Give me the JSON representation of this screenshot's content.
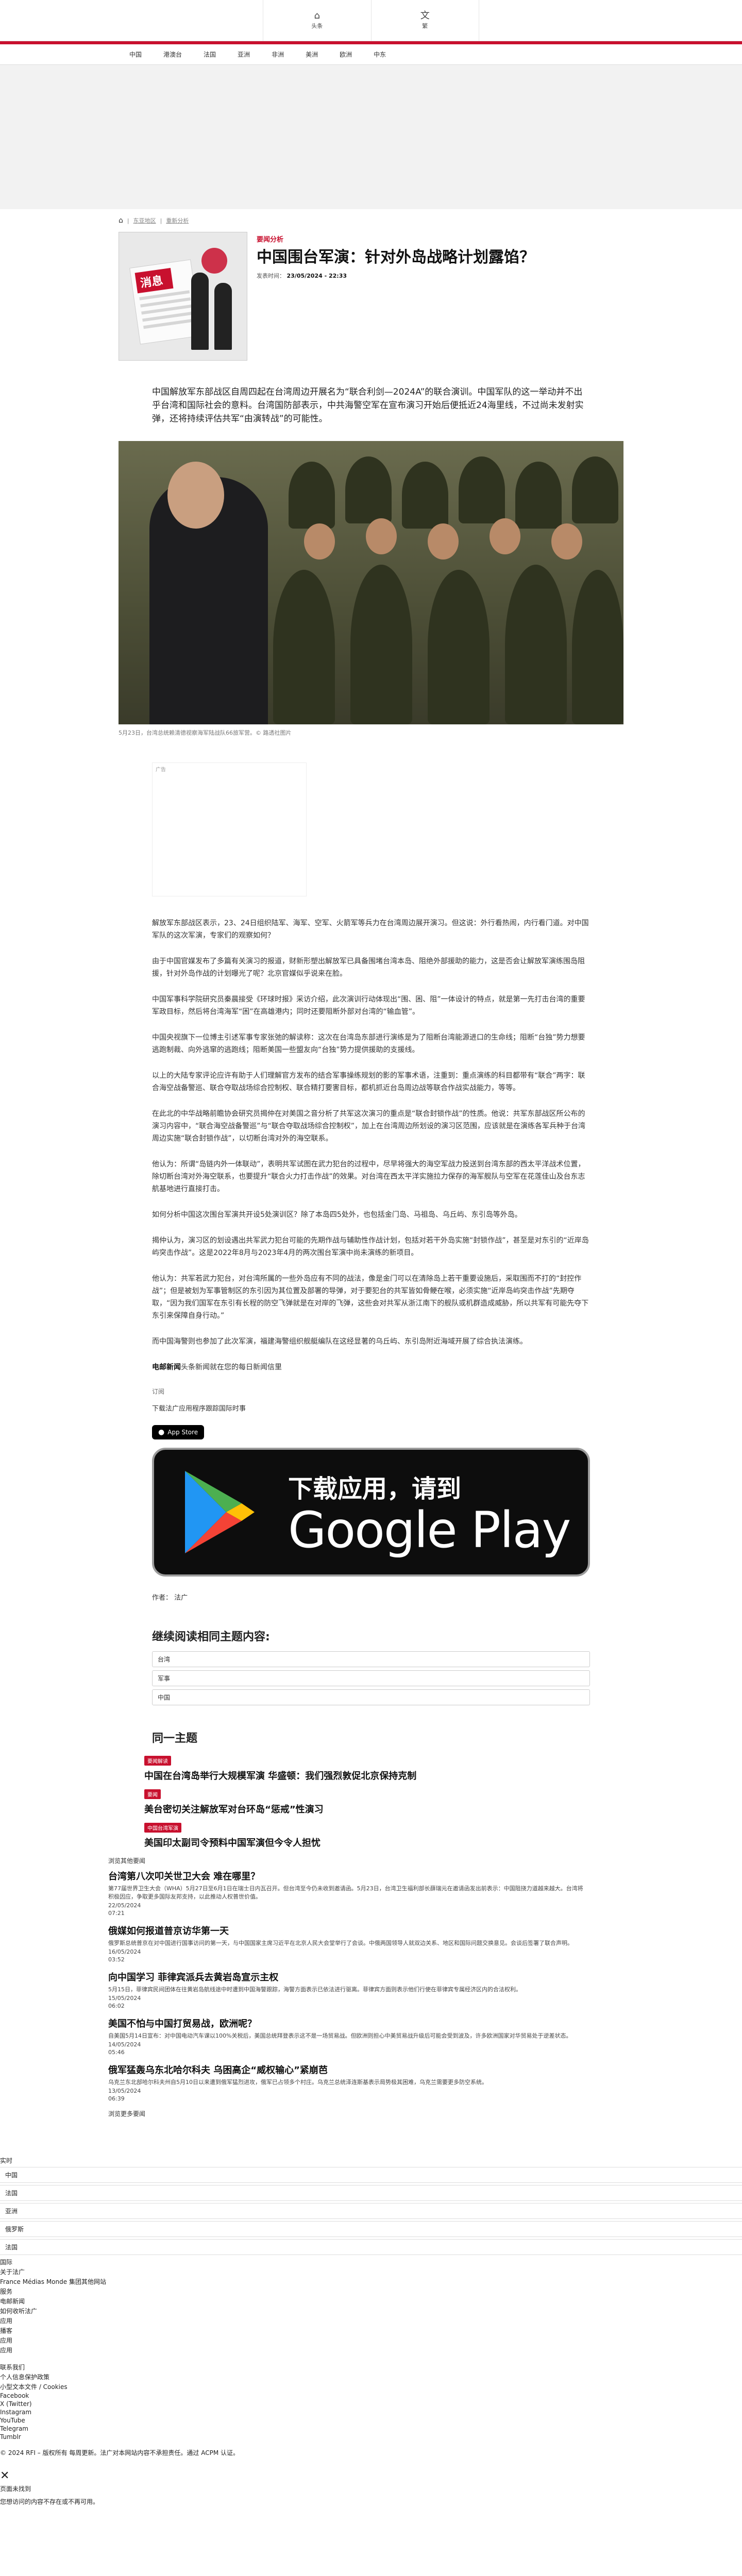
{
  "topbar": {
    "home_label": "头条",
    "lang_label": "繁"
  },
  "nav": [
    "中国",
    "港澳台",
    "法国",
    "亚洲",
    "非洲",
    "美洲",
    "欧洲",
    "中东"
  ],
  "breadcrumb": [
    "东亚地区",
    "重新分析"
  ],
  "article": {
    "kicker": "要闻分析",
    "title": "中国围台军演：针对外岛战略计划露馅？",
    "date_label": "发表时间：",
    "date": "23/05/2024 - 22:33",
    "lead": "中国解放军东部战区自周四起在台湾周边开展名为“联合利剑—2024A”的联合演训。中国军队的这一举动并不出乎台湾和国际社会的意料。台湾国防部表示，中共海警空军在宣布演习开始后便抵近24海里线，不过尚未发射实弹，还将持续评估共军“由演转战”的可能性。",
    "caption": "5月23日，台湾总统赖清德视察海军陆战队66旅军营。© 路透社图片",
    "ad_label": "广告",
    "paragraphs": [
      "解放军东部战区表示，23、24日组织陆军、海军、空军、火箭军等兵力在台湾周边展开演习。但这说：外行看热闹，内行看门道。对中国军队的这次军演，专家们的观察如何？",
      "由于中国官媒发布了多篇有关演习的报道，财新形塑出解放军已具备围堵台湾本岛、阻绝外部援助的能力，这是否会让解放军演练围岛阻援，针对外岛作战的计划曝光了呢？北京官媒似乎说来在脸。",
      "中国军事科学院研究员秦晨接受《环球时报》采访介绍，此次演训行动体现出“围、困、阻”一体设计的特点，就是第一先打击台湾的重要军政目标，然后将台湾海军“困”在高雄港内；同时还要阻断外部对台湾的“输血管”。",
      "中国央视旗下一位博主引述军事专家张弛的解读称：这次在台湾岛东部进行演练是为了阻断台湾能源进口的生命线；阻断“台独”势力想要逃跑制裁、向外逃窜的逃跑线；阻断美国一些盟友向“台独”势力提供援助的支援线。",
      "以上的大陆专家评论应许有助于人们理解官方发布的结合军事操练规划的影的军事术语，注重到：重点演练的科目都带有“联合”两字：联合海空战备警巡、联合夺取战场综合控制权、联合精打要害目标，都机抓近台岛周边战等联合作战实战能力，等等。",
      "在此北的中华战略前瞻协会研究员揭仲在对美国之音分析了共军这次演习的重点是“联合封锁作战”的性质。他说：共军东部战区所公布的演习内容中，“联合海空战备警巡”与“联合夺取战场综合控制权”，加上在台湾周边所划设的演习区范围，应该就是在演练各军兵种于台湾周边实施“联合封锁作战”，以切断台湾对外的海空联系。",
      "他认为：所谓“岛链内外一体联动”，表明共军试图在武力犯台的过程中，尽早将强大的海空军战力投送到台湾东部的西太平洋战术位置，除切断台湾对外海空联系，也要提升“联合火力打击作战”的效果。对台湾在西太平洋实施拉力保存的海军舰队与空军在花莲佳山及台东志航基地进行直接打击。",
      "如何分析中国这次围台军演共开设5处演训区？除了本岛四5处外，也包括金门岛、马祖岛、乌丘屿、东引岛等外岛。",
      "揭仲认为，演习区的划设遇出共军武力犯台可能的先期作战与辅助性作战计划，包括对若干外岛实施“封锁作战”，甚至是对东引的“近岸岛屿突击作战”。这是2022年8月与2023年4月的两次围台军演中尚未演练的新项目。",
      "他认为：共军若武力犯台，对台湾所属的一些外岛应有不同的战法，像是金门可以在清除岛上若干重要设施后，采取围而不打的“封控作战”；但是被划为军事管制区的东引因为其位置及部署的导弹，对于要犯台的共军皆如骨鲠在喉，必须实施“近岸岛屿突击作战”先期夺取，“因为我们国军在东引有长程的防空飞弹就是在对岸的飞弹，这些会对共军从浙江南下的舰队或机群造成威胁，所以共军有可能先夺下东引来保障自身行动。”",
      "而中国海警则也参加了此次军演，福建海警组织舰艇编队在这经显著的乌丘屿、东引岛附近海域开展了综合执法演练。"
    ],
    "promo_bold": "电邮新闻",
    "promo_rest": "头条新闻就在您的每日新闻信里",
    "subscribe_label": "订阅",
    "app_line": "下载法广应用程序跟踪国际时事",
    "appstore_label": "App Store",
    "gplay_line1": "下载应用，请到",
    "gplay_line2": "Google Play",
    "author_label": "作者：",
    "author": "法广"
  },
  "related": {
    "heading": "继续阅读相同主题内容:",
    "tags": [
      "台湾",
      "军事",
      "中国"
    ]
  },
  "same_topic": {
    "heading": "同一主题",
    "items": [
      {
        "badge": "要闻解读",
        "title": "中国在台湾岛举行大规模军演 华盛顿：我们强烈敦促北京保持克制"
      },
      {
        "badge": "要闻",
        "title": "美台密切关注解放军对台环岛“惩戒”性演习"
      },
      {
        "badge": "中国台湾军演",
        "title": "美国印太副司令预料中国军演但今令人担忧"
      }
    ]
  },
  "more": {
    "label": "浏览其他要闻",
    "items": [
      {
        "title": "台湾第八次叩关世卫大会 难在哪里？",
        "summary": "第77届世界卫生大会（WHA）5月27日至6月1日在瑞士日内瓦召开。但台湾至今仍未收到邀请函。5月23日，台湾卫生福利部长薛瑞元在邀请函发出前表示：中国阻挠力道越来越大。台湾将积极因应，争取更多国际友邦支持，以此推动人权普世价值。",
        "date": "22/05/2024",
        "time": "07:21"
      },
      {
        "title": "俄媒如何报道普京访华第一天",
        "summary": "俄罗斯总统普京在对中国进行国事访问的第一天，与中国国家主席习近平在北京人民大会堂举行了会谈。中俄两国领导人就双边关系、地区和国际问题交换意见。会谈后签署了联合声明。",
        "date": "16/05/2024",
        "time": "03:52"
      },
      {
        "title": "向中国学习 菲律宾派兵去黄岩岛宣示主权",
        "summary": "5月15日，菲律宾民间团体在往黄岩岛航线途中时遭到中国海警跟踪，海警方面表示已依法进行驱离。菲律宾方面则表示他们行使在菲律宾专属经济区内的合法权利。",
        "date": "15/05/2024",
        "time": "06:02"
      },
      {
        "title": "美国不怕与中国打贸易战，欧洲呢？",
        "summary": "自美国5月14日宣布：对中国电动汽车课以100%关税后，美国总统拜登表示这不是一场贸易战。但欧洲则担心中美贸易战升级后可能会受到波及，许多欧洲国家对华贸易处于逆差状态。",
        "date": "14/05/2024",
        "time": "05:46"
      },
      {
        "title": "俄军猛轰乌东北哈尔科夫 乌困高企“威权输心”紧崩芭",
        "summary": "乌克兰东北部哈尔科夫州自5月10日以来遭到俄军猛烈进攻，俄军已占领多个村庄。乌克兰总统泽连斯基表示局势极其困难，乌克兰需要更多防空系统。",
        "date": "13/05/2024",
        "time": "06:39"
      }
    ],
    "view_more": "浏览更多要闻"
  },
  "footer": {
    "live_label": "实时",
    "boxes": [
      "中国",
      "法国",
      "亚洲",
      "俄罗斯",
      "法国"
    ],
    "lines": [
      "国际",
      "关于法广",
      "France Médias Monde 集团其他网站",
      "服务",
      "电邮新闻",
      "如何收听法广",
      "应用",
      "播客",
      "应用",
      "应用"
    ],
    "links2": [
      "联系我们",
      "个人信息保护政策",
      "小型文本文件 / Cookies",
      "Facebook",
      "X (Twitter)",
      "Instagram",
      "YouTube",
      "Telegram",
      "Tumblr"
    ],
    "copyright": "© 2024 RFI – 版权所有 每周更新。法广对本网站内容不承担责任。通过 ACPM 认证。",
    "close_label": "✕",
    "unavail1": "页面未找到",
    "unavail2": "您想访问的内容不存在或不再可用。"
  }
}
